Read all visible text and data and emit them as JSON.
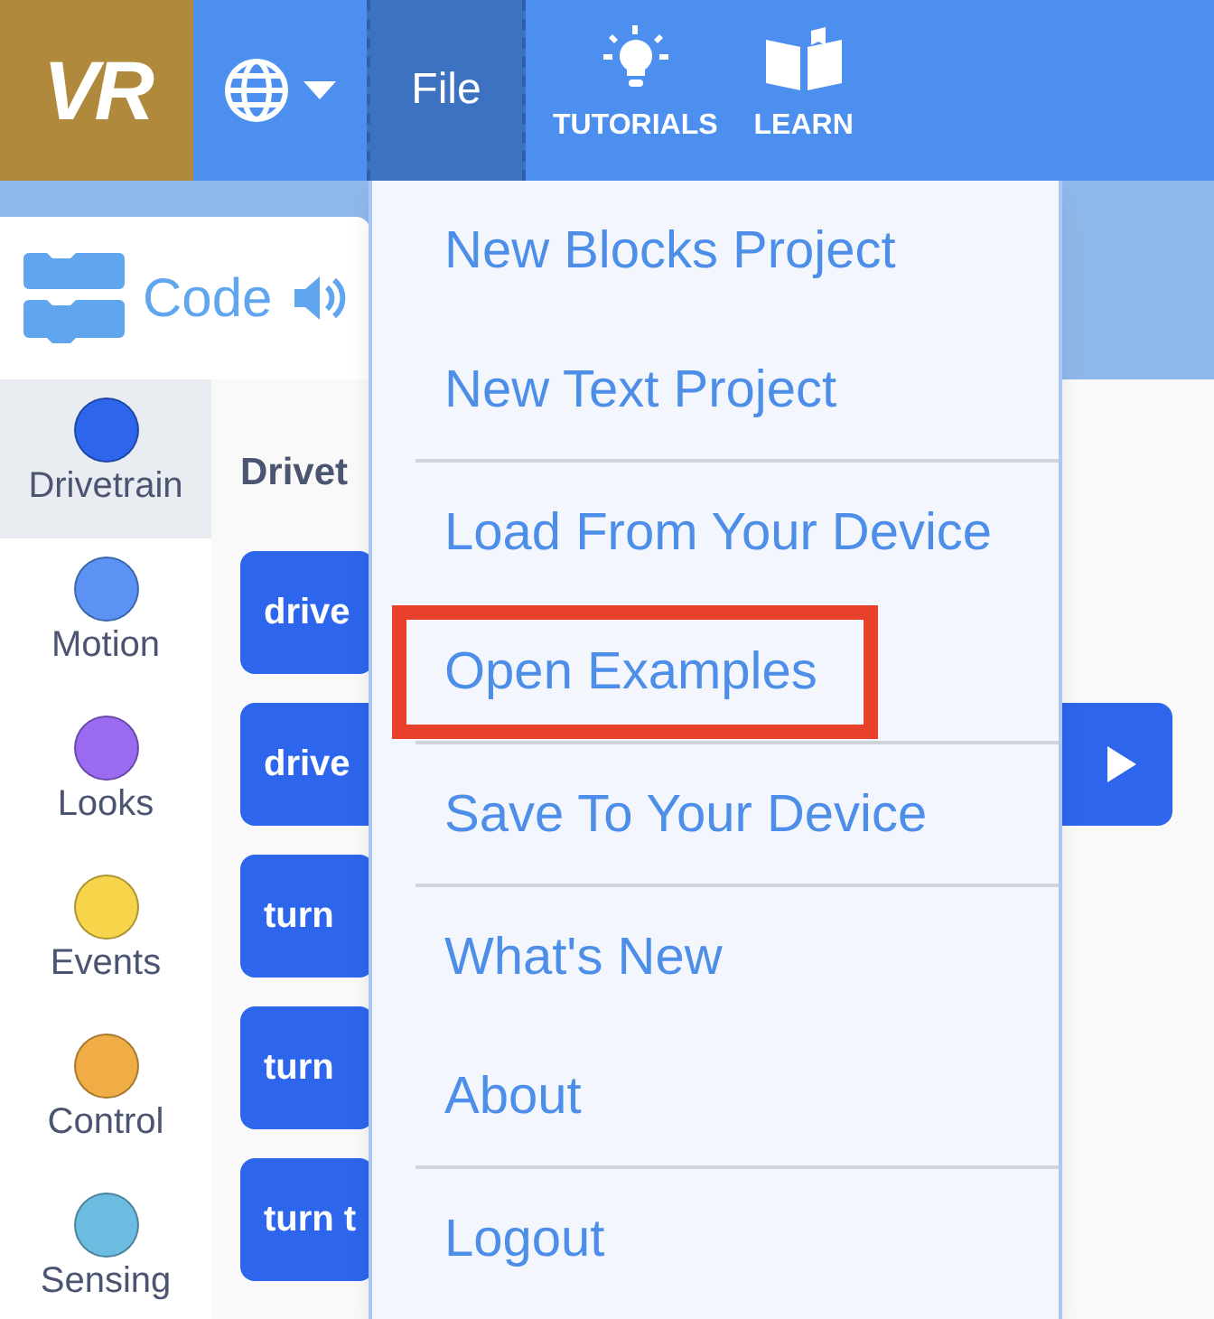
{
  "menu_bar": {
    "items": [
      {
        "kind": "logo",
        "label": "VR"
      },
      {
        "kind": "language"
      },
      {
        "kind": "menu",
        "label": "File",
        "selected": true
      },
      {
        "kind": "tutorials",
        "label": "TUTORIALS"
      },
      {
        "kind": "learn",
        "label": "LEARN"
      }
    ]
  },
  "code_tab": {
    "label": "Code"
  },
  "categories": [
    {
      "label": "Drivetrain",
      "color": "#2d66ec",
      "selected": true
    },
    {
      "label": "Motion",
      "color": "#5b92f3",
      "selected": false
    },
    {
      "label": "Looks",
      "color": "#9a6bf0",
      "selected": false
    },
    {
      "label": "Events",
      "color": "#f7d54a",
      "selected": false
    },
    {
      "label": "Control",
      "color": "#f1ad45",
      "selected": false
    },
    {
      "label": "Sensing",
      "color": "#6bbce0",
      "selected": false
    }
  ],
  "palette": {
    "heading": "Drivet",
    "blocks": [
      {
        "label": "drive",
        "kind": "plain"
      },
      {
        "label": "drive",
        "kind": "runnable"
      },
      {
        "label": "turn",
        "kind": "plain"
      },
      {
        "label": "turn",
        "kind": "plain"
      },
      {
        "label": "turn t",
        "kind": "plain"
      }
    ]
  },
  "file_menu": {
    "items": [
      {
        "kind": "item",
        "label": "New Blocks Project",
        "highlighted": false
      },
      {
        "kind": "item",
        "label": "New Text Project",
        "highlighted": false
      },
      {
        "kind": "divider"
      },
      {
        "kind": "item",
        "label": "Load From Your Device",
        "highlighted": false
      },
      {
        "kind": "item",
        "label": "Open Examples",
        "highlighted": true
      },
      {
        "kind": "divider"
      },
      {
        "kind": "item",
        "label": "Save To Your Device",
        "highlighted": false
      },
      {
        "kind": "divider"
      },
      {
        "kind": "item",
        "label": "What's New",
        "highlighted": false
      },
      {
        "kind": "item",
        "label": "About",
        "highlighted": false
      },
      {
        "kind": "divider"
      },
      {
        "kind": "item",
        "label": "Logout",
        "highlighted": false
      }
    ]
  }
}
